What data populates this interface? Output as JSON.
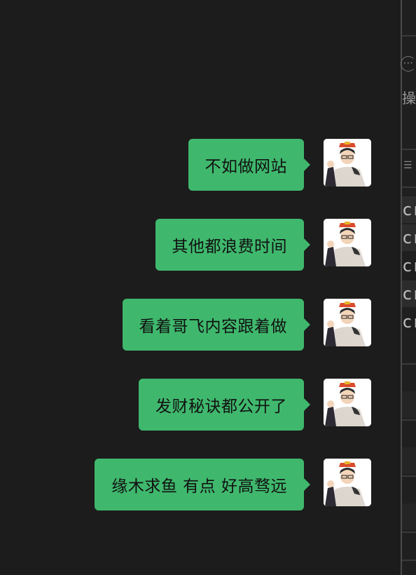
{
  "messages": [
    {
      "text": "不如做网站"
    },
    {
      "text": "其他都浪费时间"
    },
    {
      "text": "看着哥飞内容跟着做"
    },
    {
      "text": "发财秘诀都公开了"
    },
    {
      "text": "缘木求鱼 有点 好高骛远"
    }
  ],
  "side_panel": {
    "more_icon": "more-circle-icon",
    "action_label": "操",
    "list_icon": "list-icon",
    "row_fragments": [
      "cr",
      "cr",
      "cr",
      "cr",
      "cr"
    ]
  },
  "colors": {
    "background": "#1c1c1c",
    "bubble_sent": "#3fb86d",
    "bubble_text": "#111111"
  }
}
